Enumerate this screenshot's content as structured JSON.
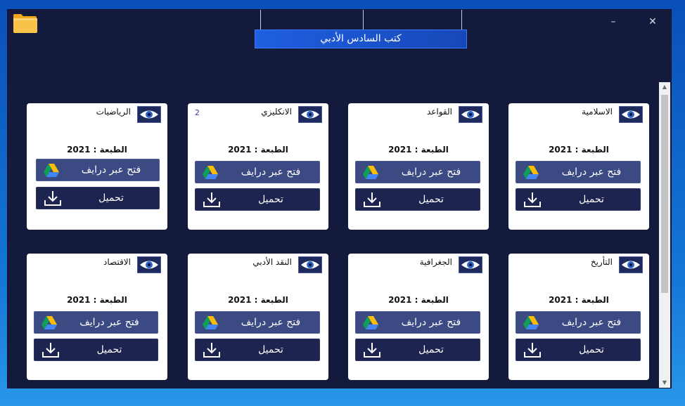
{
  "window": {
    "title": "كتب السادس الأدبي",
    "minimize_symbol": "–",
    "close_symbol": "✕",
    "app_icon": "folder-icon"
  },
  "scrollbar": {
    "up_arrow": "▲",
    "down_arrow": "▼"
  },
  "books": [
    {
      "title": "الاسلامية",
      "edition": "الطبعة : 2021",
      "drive_label": "فتح عبر درايف",
      "download_label": "تحميل",
      "badge": ""
    },
    {
      "title": "القواعد",
      "edition": "الطبعة : 2021",
      "drive_label": "فتح عبر درايف",
      "download_label": "تحميل",
      "badge": ""
    },
    {
      "title": "الانكليزي",
      "edition": "الطبعة : 2021",
      "drive_label": "فتح عبر درايف",
      "download_label": "تحميل",
      "badge": "2"
    },
    {
      "title": "الرياضيات",
      "edition": "الطبعة : 2021",
      "drive_label": "فتح عبر درايف",
      "download_label": "تحميل",
      "badge": ""
    },
    {
      "title": "التأريخ",
      "edition": "الطبعة : 2021",
      "drive_label": "فتح عبر درايف",
      "download_label": "تحميل",
      "badge": ""
    },
    {
      "title": "الجغرافية",
      "edition": "الطبعة : 2021",
      "drive_label": "فتح عبر درايف",
      "download_label": "تحميل",
      "badge": ""
    },
    {
      "title": "النقد الأدبي",
      "edition": "الطبعة : 2021",
      "drive_label": "فتح عبر درايف",
      "download_label": "تحميل",
      "badge": ""
    },
    {
      "title": "الاقتصاد",
      "edition": "الطبعة : 2021",
      "drive_label": "فتح عبر درايف",
      "download_label": "تحميل",
      "badge": ""
    }
  ],
  "colors": {
    "window_bg": "#141a3c",
    "title_bar": "#1f5fe0",
    "drive_button": "#3b4a82",
    "download_button": "#1e2450",
    "card_bg": "#ffffff"
  }
}
